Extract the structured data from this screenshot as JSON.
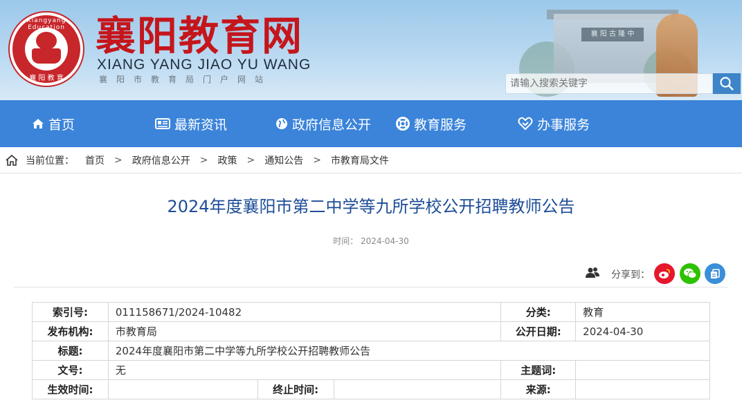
{
  "site": {
    "logo_ring_text": "Xiangyang Education",
    "logo_bottom_text": "襄 阳 教 育",
    "title": "襄阳教育网",
    "pinyin": "XIANG YANG JIAO YU WANG",
    "subtitle": "襄阳市教育局门户网站",
    "scene_plaque": "襄 阳 古 隆 中"
  },
  "search": {
    "placeholder": "请输入搜索关键字"
  },
  "nav": {
    "items": [
      {
        "label": "首页",
        "icon": "home-icon"
      },
      {
        "label": "最新资讯",
        "icon": "news-icon"
      },
      {
        "label": "政府信息公开",
        "icon": "globe-icon"
      },
      {
        "label": "教育服务",
        "icon": "lifebuoy-icon"
      },
      {
        "label": "办事服务",
        "icon": "handshake-icon"
      }
    ]
  },
  "breadcrumb": {
    "prefix": "当前位置：",
    "items": [
      "首页",
      "政府信息公开",
      "政策",
      "通知公告",
      "市教育局文件"
    ],
    "separator": ">"
  },
  "article": {
    "title": "2024年度襄阳市第二中学等九所学校公开招聘教师公告",
    "time": "时间：  2024-04-30"
  },
  "share": {
    "label": "分享到：",
    "icons": [
      "weibo-icon",
      "wechat-icon",
      "copy-icon"
    ],
    "colors": {
      "weibo": "#e6162d",
      "wechat": "#2dc100",
      "copy": "#3b8ed8"
    }
  },
  "info": {
    "index_label": "索引号:",
    "index_value": "011158671/2024-10482",
    "category_label": "分类:",
    "category_value": "教育",
    "publisher_label": "发布机构:",
    "publisher_value": "市教育局",
    "date_label": "公开日期:",
    "date_value": "2024-04-30",
    "title_label": "标题:",
    "title_value": "2024年度襄阳市第二中学等九所学校公开招聘教师公告",
    "docno_label": "文号:",
    "docno_value": "无",
    "topic_label": "主题词:",
    "topic_value": "",
    "effective_label": "生效时间:",
    "effective_value": "",
    "end_label": "终止时间:",
    "end_value": "",
    "source_label": "来源:",
    "source_value": ""
  },
  "colors": {
    "nav": "#3b84da",
    "title": "#1d4d97",
    "brand": "#c4161c"
  }
}
